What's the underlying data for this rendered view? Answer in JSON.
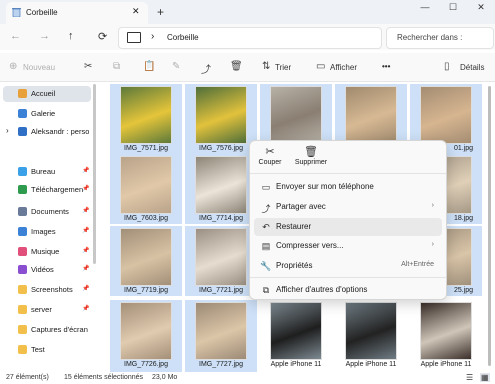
{
  "window": {
    "tab_title": "Corbeille",
    "new_tab": "+",
    "close_tab": "✕",
    "minimize": "—",
    "maximize": "☐",
    "close": "✕"
  },
  "nav": {
    "back": "←",
    "forward": "→",
    "up": "↑",
    "refresh": "⟳",
    "chevron": "›",
    "location": "Corbeille",
    "search_placeholder": "Rechercher dans :"
  },
  "toolbar": {
    "new_label": "Nouveau",
    "sort_label": "Trier",
    "view_label": "Afficher",
    "more": "•••",
    "details_label": "Détails"
  },
  "sidebar": {
    "items": [
      {
        "label": "Accueil",
        "color": "#e8a03a"
      },
      {
        "label": "Galerie",
        "color": "#3b82d6"
      },
      {
        "label": "Aleksandr : perso",
        "color": "#2f6fc6"
      },
      {
        "label": "Bureau",
        "color": "#3aa0e8"
      },
      {
        "label": "Téléchargemen",
        "color": "#2e9b4f"
      },
      {
        "label": "Documents",
        "color": "#6a7b9a"
      },
      {
        "label": "Images",
        "color": "#3b82d6"
      },
      {
        "label": "Musique",
        "color": "#e0507a"
      },
      {
        "label": "Vidéos",
        "color": "#8a4fd0"
      },
      {
        "label": "Screenshots",
        "color": "#f2c04a"
      },
      {
        "label": "server",
        "color": "#f2c04a"
      },
      {
        "label": "Captures d'écran",
        "color": "#f2c04a"
      },
      {
        "label": "Test",
        "color": "#f2c04a"
      }
    ]
  },
  "files": [
    {
      "name": "IMG_7571.jpg"
    },
    {
      "name": "IMG_7576.jpg"
    },
    {
      "name": ""
    },
    {
      "name": ""
    },
    {
      "name": "01.jpg"
    },
    {
      "name": "IMG_7603.jpg"
    },
    {
      "name": "IMG_7714.jpg"
    },
    {
      "name": ""
    },
    {
      "name": ""
    },
    {
      "name": "18.jpg"
    },
    {
      "name": "IMG_7719.jpg"
    },
    {
      "name": "IMG_7721.jpg"
    },
    {
      "name": ""
    },
    {
      "name": ""
    },
    {
      "name": "25.jpg"
    },
    {
      "name": "IMG_7726.jpg"
    },
    {
      "name": "IMG_7727.jpg"
    },
    {
      "name": "Apple iPhone 11"
    },
    {
      "name": "Apple iPhone 11"
    },
    {
      "name": "Apple iPhone 11"
    }
  ],
  "context_menu": {
    "cut_label": "Couper",
    "delete_label": "Supprimer",
    "items": [
      {
        "label": "Envoyer sur mon téléphone",
        "icon": "▭",
        "right": ""
      },
      {
        "label": "Partager avec",
        "icon": "⤴",
        "right": "›"
      },
      {
        "label": "Restaurer",
        "icon": "↶",
        "right": ""
      },
      {
        "label": "Compresser vers...",
        "icon": "▤",
        "right": "›"
      },
      {
        "label": "Propriétés",
        "icon": "🔧",
        "right": "Alt+Entrée"
      },
      {
        "label": "Afficher d'autres d'options",
        "icon": "⧉",
        "right": ""
      }
    ]
  },
  "status": {
    "count": "27 élément(s)",
    "selected": "15 éléments sélectionnés",
    "size": "23,0 Mo"
  }
}
